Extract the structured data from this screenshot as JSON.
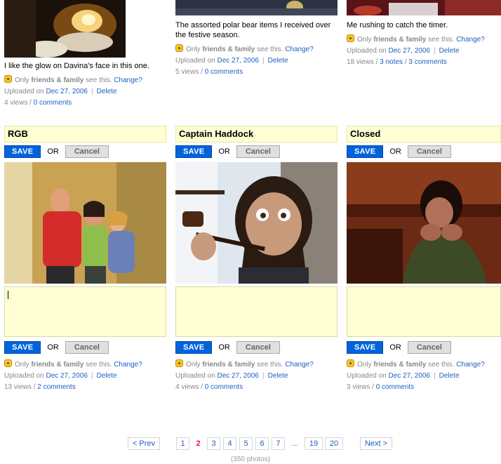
{
  "top_photos": [
    {
      "caption": "I like the glow on Davina's face in this one.",
      "privacy_prefix": "Only",
      "privacy_who": "friends & family",
      "privacy_suffix": "see this.",
      "change": "Change?",
      "uploaded_prefix": "Uploaded on",
      "date": "Dec 27, 2006",
      "delete": "Delete",
      "views": "4 views",
      "comments": "0 comments"
    },
    {
      "caption": "The assorted polar bear items I received over the festive season.",
      "privacy_prefix": "Only",
      "privacy_who": "friends & family",
      "privacy_suffix": "see this.",
      "change": "Change?",
      "uploaded_prefix": "Uploaded on",
      "date": "Dec 27, 2006",
      "delete": "Delete",
      "views": "5 views",
      "comments": "0 comments"
    },
    {
      "caption": "Me rushing to catch the timer.",
      "privacy_prefix": "Only",
      "privacy_who": "friends & family",
      "privacy_suffix": "see this.",
      "change": "Change?",
      "uploaded_prefix": "Uploaded on",
      "date": "Dec 27, 2006",
      "delete": "Delete",
      "views": "18 views",
      "notes": "3 notes",
      "comments": "3 comments"
    }
  ],
  "edit_photos": [
    {
      "title": "RGB",
      "save": "SAVE",
      "or": "OR",
      "cancel": "Cancel",
      "privacy_prefix": "Only",
      "privacy_who": "friends & family",
      "privacy_suffix": "see this.",
      "change": "Change?",
      "uploaded_prefix": "Uploaded on",
      "date": "Dec 27, 2006",
      "delete": "Delete",
      "views": "13 views",
      "comments": "2 comments"
    },
    {
      "title": "Captain Haddock",
      "save": "SAVE",
      "or": "OR",
      "cancel": "Cancel",
      "privacy_prefix": "Only",
      "privacy_who": "friends & family",
      "privacy_suffix": "see this.",
      "change": "Change?",
      "uploaded_prefix": "Uploaded on",
      "date": "Dec 27, 2006",
      "delete": "Delete",
      "views": "4 views",
      "comments": "0 comments"
    },
    {
      "title": "Closed",
      "save": "SAVE",
      "or": "OR",
      "cancel": "Cancel",
      "privacy_prefix": "Only",
      "privacy_who": "friends & family",
      "privacy_suffix": "see this.",
      "change": "Change?",
      "uploaded_prefix": "Uploaded on",
      "date": "Dec 27, 2006",
      "delete": "Delete",
      "views": "3 views",
      "comments": "0 comments"
    }
  ],
  "pagination": {
    "prev": "< Prev",
    "next": "Next >",
    "pages": [
      "1",
      "2",
      "3",
      "4",
      "5",
      "6",
      "7",
      "...",
      "19",
      "20"
    ],
    "current": "2",
    "total": "(350 photos)"
  },
  "colors": {
    "link": "#1e5fc4",
    "save_button": "#0063dc",
    "title_background": "#ffffd3",
    "current_page": "#ff0084"
  },
  "icons": {
    "privacy": "lock-icon"
  }
}
